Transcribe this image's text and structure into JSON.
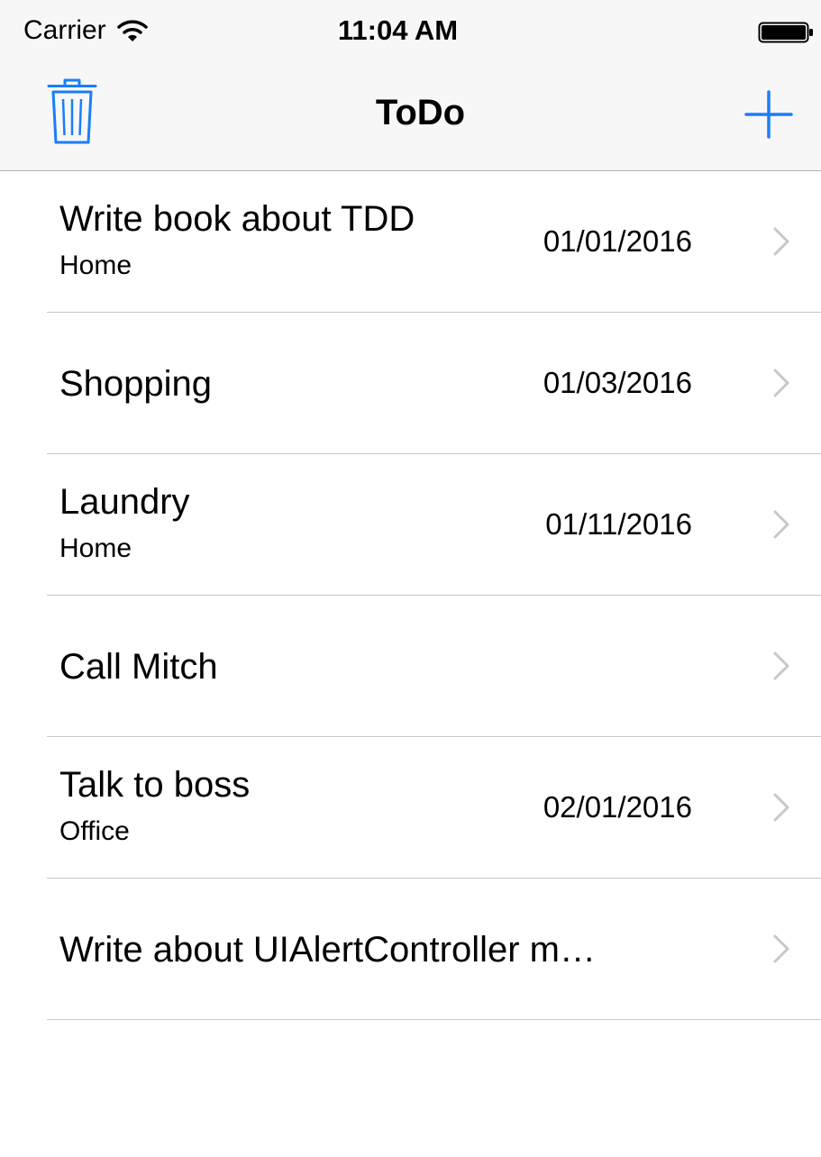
{
  "status_bar": {
    "carrier": "Carrier",
    "time": "11:04 AM"
  },
  "nav": {
    "title": "ToDo",
    "left_icon": "trash-icon",
    "right_icon": "plus-icon",
    "tint_color": "#1a7ef9"
  },
  "items": [
    {
      "title": "Write book about TDD",
      "location": "Home",
      "date": "01/01/2016"
    },
    {
      "title": "Shopping",
      "location": "",
      "date": "01/03/2016"
    },
    {
      "title": "Laundry",
      "location": "Home",
      "date": "01/11/2016"
    },
    {
      "title": "Call Mitch",
      "location": "",
      "date": ""
    },
    {
      "title": "Talk to boss",
      "location": "Office",
      "date": "02/01/2016"
    },
    {
      "title": "Write about UIAlertController m…",
      "location": "",
      "date": ""
    }
  ]
}
